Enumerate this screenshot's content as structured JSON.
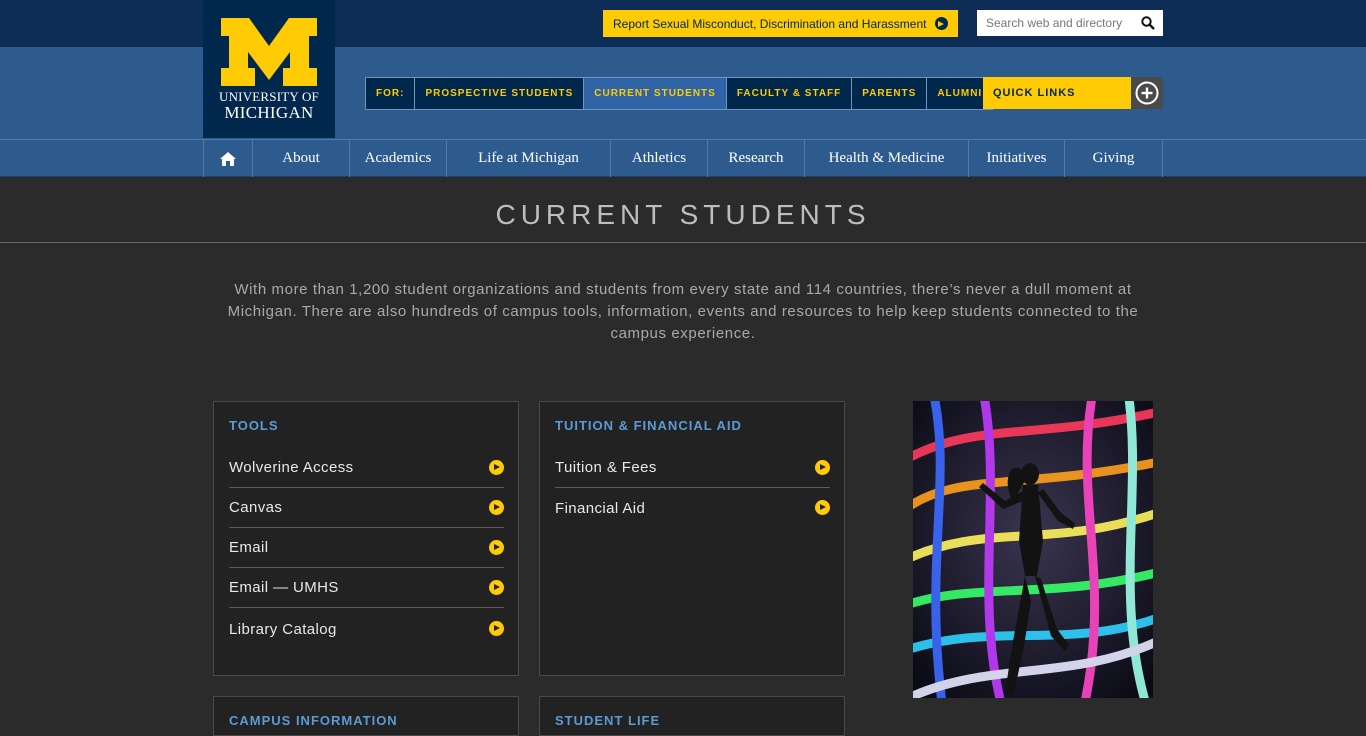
{
  "header": {
    "logo_line1": "UNIVERSITY OF",
    "logo_line2": "MICHIGAN",
    "report_label": "Report Sexual Misconduct, Discrimination and Harassment",
    "search_placeholder": "Search web and directory"
  },
  "audience_nav": [
    {
      "label": "FOR:"
    },
    {
      "label": "PROSPECTIVE STUDENTS"
    },
    {
      "label": "CURRENT STUDENTS"
    },
    {
      "label": "FACULTY & STAFF"
    },
    {
      "label": "PARENTS"
    },
    {
      "label": "ALUMNI"
    }
  ],
  "quick_links": {
    "label": "QUICK LINKS"
  },
  "main_nav": [
    {
      "label": "About"
    },
    {
      "label": "Academics"
    },
    {
      "label": "Life at Michigan"
    },
    {
      "label": "Athletics"
    },
    {
      "label": "Research"
    },
    {
      "label": "Health & Medicine"
    },
    {
      "label": "Initiatives"
    },
    {
      "label": "Giving"
    }
  ],
  "page": {
    "title": "CURRENT STUDENTS",
    "intro": "With more than 1,200 student organizations and students from every state and 114 countries, there’s never a dull moment at Michigan. There are also hundreds of campus tools, information, events and resources to help keep students connected to the campus experience."
  },
  "cards": {
    "tools": {
      "title": "TOOLS",
      "links": [
        "Wolverine Access",
        "Canvas",
        "Email",
        "Email — UMHS",
        "Library Catalog"
      ]
    },
    "tuition": {
      "title": "TUITION & FINANCIAL AID",
      "links": [
        "Tuition & Fees",
        "Financial Aid"
      ]
    },
    "campus": {
      "title": "CAMPUS INFORMATION"
    },
    "student_life": {
      "title": "STUDENT LIFE"
    }
  },
  "colors": {
    "maize": "#ffcb05",
    "blue": "#00274c",
    "nav_blue": "#2d5b8e",
    "link_blue": "#5b9bd5"
  }
}
